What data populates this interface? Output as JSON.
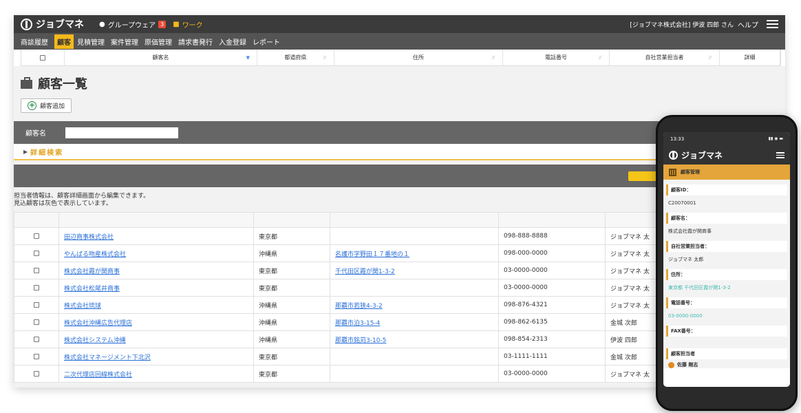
{
  "app": {
    "brand": "ジョブマネ",
    "nav": {
      "groupware": "グループウェア",
      "groupware_badge": "3",
      "work": "ワーク"
    },
    "user_info": "[ジョブマネ株式会社] 伊波 四郎 さん",
    "help": "ヘルプ"
  },
  "subnav": [
    "商談履歴",
    "顧客",
    "見積管理",
    "案件管理",
    "原価管理",
    "請求書発行",
    "入金登録",
    "レポート"
  ],
  "subnav_active": "顧客",
  "grid_header": [
    "顧客名",
    "都道府県",
    "住所",
    "電話番号",
    "自社営業担当者",
    "詳細"
  ],
  "page": {
    "title": "顧客一覧",
    "add_button": "顧客追加",
    "search_label": "顧客名",
    "search_value": "",
    "detail_search": "詳細検索",
    "note_line1": "担当者情報は、顧客詳細画面から編集できます。",
    "note_line2": "見込顧客は灰色で表示しています。"
  },
  "rows": [
    {
      "name": "田辺商事株式会社",
      "pref": "東京都",
      "address": "",
      "phone": "098-888-8888",
      "rep": "ジョブマネ 太"
    },
    {
      "name": "やんばる吻産株式会社",
      "pref": "沖縄県",
      "address": "名護市字野田１７番地の１",
      "phone": "098-000-0000",
      "rep": "ジョブマネ 太"
    },
    {
      "name": "株式会社霞が関商事",
      "pref": "東京都",
      "address": "千代田区霞が関1-3-2",
      "phone": "03-0000-0000",
      "rep": "ジョブマネ 太"
    },
    {
      "name": "株式会社松尾井商事",
      "pref": "東京都",
      "address": "",
      "phone": "03-0000-0000",
      "rep": "ジョブマネ 太"
    },
    {
      "name": "株式会社琉球",
      "pref": "沖縄県",
      "address": "那覇市若狭4-3-2",
      "phone": "098-876-4321",
      "rep": "ジョブマネ 太"
    },
    {
      "name": "株式会社沖縄広告代理店",
      "pref": "沖縄県",
      "address": "那覇市泊3-15-4",
      "phone": "098-862-6135",
      "rep": "金城 次郎"
    },
    {
      "name": "株式会社システム沖縄",
      "pref": "沖縄県",
      "address": "那覇市銘苅3-10-5",
      "phone": "098-854-2313",
      "rep": "伊波 四郎"
    },
    {
      "name": "株式会社マネージメント下北沢",
      "pref": "東京都",
      "address": "",
      "phone": "03-1111-1111",
      "rep": "金城 次郎"
    },
    {
      "name": "二次代理店回線株式会社",
      "pref": "東京都",
      "address": "",
      "phone": "03-0000-0000",
      "rep": "ジョブマネ 太"
    }
  ],
  "mobile": {
    "time": "13:33",
    "brand": "ジョブマネ",
    "section": "顧客管理",
    "id_label": "顧客ID：",
    "id_value": "C20070001",
    "name_label": "顧客名：",
    "name_value": "株式会社霞が関商事",
    "rep_label": "自社営業担当者：",
    "rep_value": "ジョブマネ 太郎",
    "address_label": "住所：",
    "address_value": "東京都 千代田区霞が関1-3-2",
    "phone_label": "電話番号：",
    "phone_value": "03-0000-0000",
    "fax_label": "FAX番号：",
    "contact_label": "顧客担当者",
    "contact_name": "佐藤 剛志"
  },
  "colors": {
    "accent": "#f5b91b",
    "topbar": "#3b3b3b",
    "link": "#2a6fd8",
    "mobile_accent": "#e4a53a"
  }
}
